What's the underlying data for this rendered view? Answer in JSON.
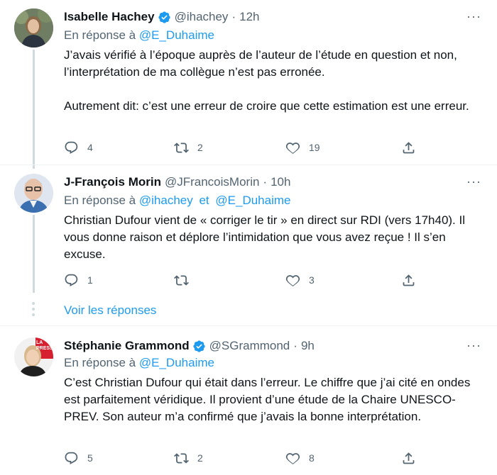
{
  "tweets": [
    {
      "name": "Isabelle Hachey",
      "verified": true,
      "handle": "@ihachey",
      "separator": "·",
      "time": "12h",
      "reply_prefix": "En réponse à",
      "reply_to": [
        "@E_Duhaime"
      ],
      "paragraphs": [
        "J’avais vérifié à l’époque auprès de l’auteur de l’étude en question et non, l’interprétation de ma collègue n’est pas erronée.",
        "Autrement dit: c’est une erreur de croire que cette estimation est une erreur."
      ],
      "replies": "4",
      "retweets": "2",
      "likes": "19"
    },
    {
      "name": "J-François Morin",
      "verified": false,
      "handle": "@JFrancoisMorin",
      "separator": "·",
      "time": "10h",
      "reply_prefix": "En réponse à",
      "reply_to": [
        "@ihachey",
        "@E_Duhaime"
      ],
      "reply_joiner": "et",
      "paragraphs": [
        "Christian Dufour vient de « corriger le tir » en direct sur RDI (vers 17h40). Il vous donne raison et déplore l’intimidation que vous avez reçue ! Il s’en excuse."
      ],
      "replies": "1",
      "retweets": "",
      "likes": "3"
    },
    {
      "name": "Stéphanie Grammond",
      "verified": true,
      "handle": "@SGrammond",
      "separator": "·",
      "time": "9h",
      "reply_prefix": "En réponse à",
      "reply_to": [
        "@E_Duhaime"
      ],
      "paragraphs": [
        "C’est Christian Dufour qui était dans l’erreur. Le chiffre que j’ai cité en ondes est parfaitement véridique. Il provient d’une étude de la Chaire UNESCO-PREV. Son auteur m’a confirmé que j’avais la bonne interprétation."
      ],
      "replies": "5",
      "retweets": "2",
      "likes": "8"
    }
  ],
  "show_replies_label": "Voir les réponses",
  "more_glyph": "···",
  "avatar_badge_text": "LA PRESSE",
  "colors": {
    "link": "#1d9bf0",
    "verified": "#1d9bf0",
    "secondary": "#536471",
    "thread_line": "#cfd9de",
    "la_presse_red": "#d6202f"
  },
  "icons": [
    "reply-icon",
    "retweet-icon",
    "like-icon",
    "share-icon",
    "more-icon",
    "verified-badge-icon"
  ]
}
